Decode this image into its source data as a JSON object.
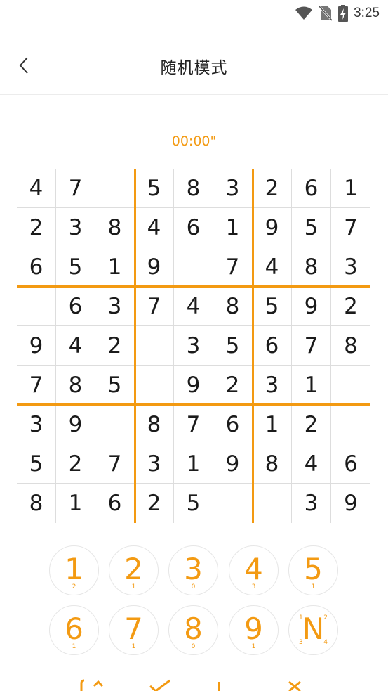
{
  "status_bar": {
    "time": "3:25",
    "icons": [
      "wifi-icon",
      "no-sim-icon",
      "battery-charging-icon"
    ]
  },
  "header": {
    "title": "随机模式",
    "back_icon": "chevron-left-icon"
  },
  "timer": "00:00\"",
  "colors": {
    "accent": "#f39a12",
    "grid_line": "#dddddd",
    "digit": "#1b1b1b"
  },
  "board": {
    "rows": [
      [
        "4",
        "7",
        "",
        "5",
        "8",
        "3",
        "2",
        "6",
        "1"
      ],
      [
        "2",
        "3",
        "8",
        "4",
        "6",
        "1",
        "9",
        "5",
        "7"
      ],
      [
        "6",
        "5",
        "1",
        "9",
        "",
        "7",
        "4",
        "8",
        "3"
      ],
      [
        "",
        "6",
        "3",
        "7",
        "4",
        "8",
        "5",
        "9",
        "2"
      ],
      [
        "9",
        "4",
        "2",
        "",
        "3",
        "5",
        "6",
        "7",
        "8"
      ],
      [
        "7",
        "8",
        "5",
        "",
        "9",
        "2",
        "3",
        "1",
        ""
      ],
      [
        "3",
        "9",
        "",
        "8",
        "7",
        "6",
        "1",
        "2",
        ""
      ],
      [
        "5",
        "2",
        "7",
        "3",
        "1",
        "9",
        "8",
        "4",
        "6"
      ],
      [
        "8",
        "1",
        "6",
        "2",
        "5",
        "",
        "",
        "3",
        "9"
      ]
    ]
  },
  "numpad": {
    "buttons": [
      {
        "digit": "1",
        "remaining": "2"
      },
      {
        "digit": "2",
        "remaining": "1"
      },
      {
        "digit": "3",
        "remaining": "0"
      },
      {
        "digit": "4",
        "remaining": "3"
      },
      {
        "digit": "5",
        "remaining": "1"
      },
      {
        "digit": "6",
        "remaining": "1"
      },
      {
        "digit": "7",
        "remaining": "1"
      },
      {
        "digit": "8",
        "remaining": "0"
      },
      {
        "digit": "9",
        "remaining": "1"
      }
    ],
    "notes_button": {
      "label": "N",
      "corners": [
        "1",
        "2",
        "3",
        "4"
      ]
    }
  },
  "toolbar": {
    "icons": [
      "undo-icon",
      "check-icon",
      "pencil-icon",
      "erase-icon"
    ]
  }
}
